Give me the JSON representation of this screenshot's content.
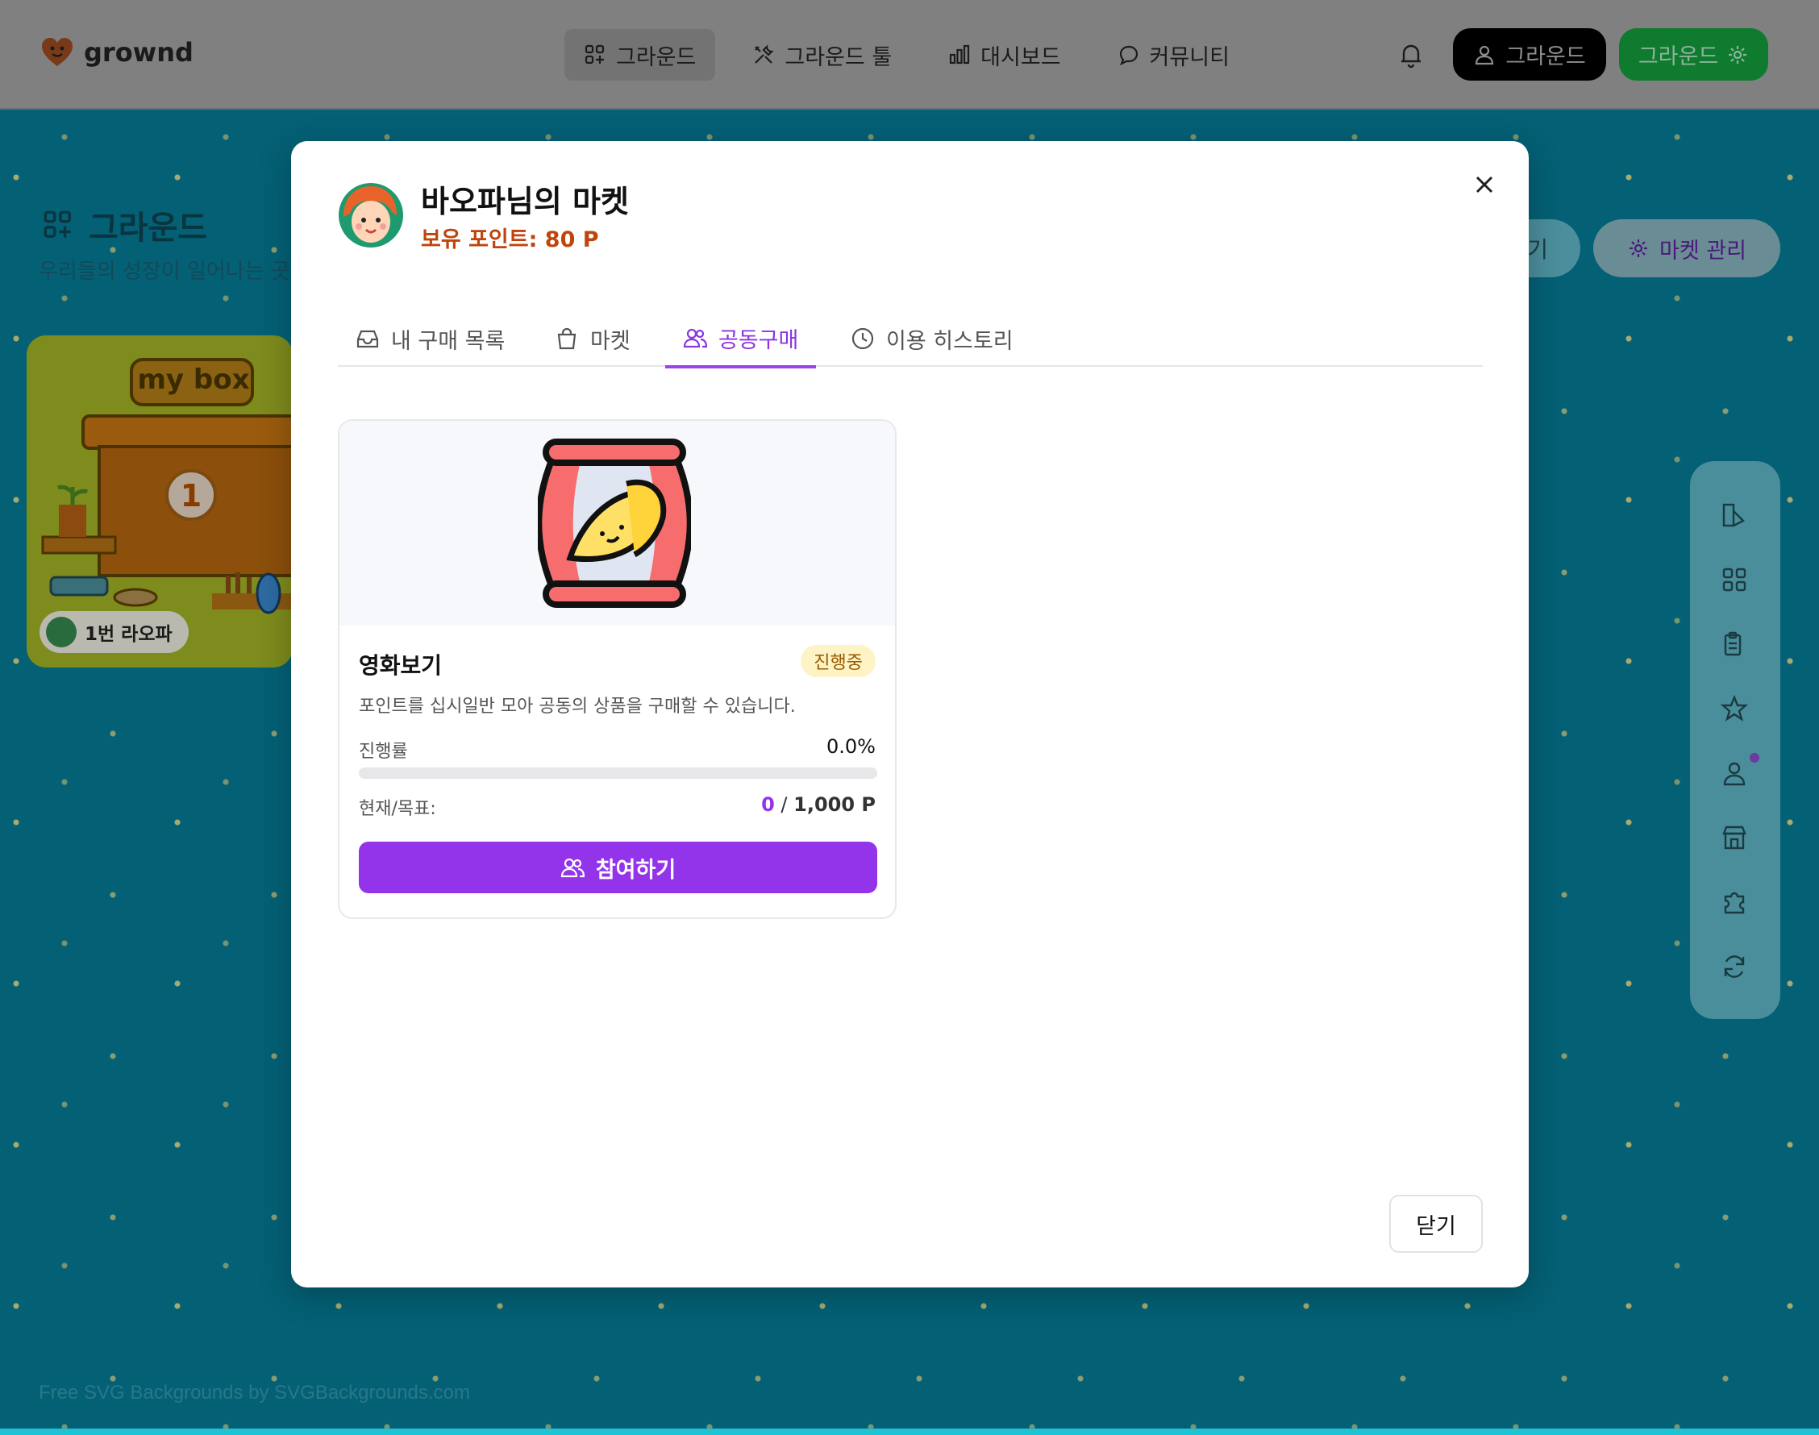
{
  "app": {
    "logo_text": "grownd"
  },
  "nav": [
    {
      "label": "그라운드",
      "icon": "grid-plus-icon",
      "active": true
    },
    {
      "label": "그라운드 툴",
      "icon": "tools-icon",
      "active": false
    },
    {
      "label": "대시보드",
      "icon": "bar-chart-icon",
      "active": false
    },
    {
      "label": "커뮤니티",
      "icon": "chat-bubble-icon",
      "active": false
    }
  ],
  "header_right": {
    "user_button": "그라운드",
    "ground_button": "그라운드"
  },
  "page": {
    "title": "그라운드",
    "subtitle": "우리들의 성장이 일어나는 곳",
    "btn_partial": "기",
    "btn_market_manage": "마켓 관리",
    "mybox_label": "1번 라오파",
    "credit": "Free SVG Backgrounds by SVGBackgrounds.com"
  },
  "modal": {
    "title": "바오파님의 마켓",
    "points": "보유 포인트: 80 P",
    "tabs": [
      {
        "label": "내 구매 목록",
        "icon": "inbox-icon"
      },
      {
        "label": "마켓",
        "icon": "shopping-bag-icon"
      },
      {
        "label": "공동구매",
        "icon": "users-icon"
      },
      {
        "label": "이용 히스토리",
        "icon": "clock-icon"
      }
    ],
    "active_tab": 2,
    "card": {
      "name": "영화보기",
      "status": "진행중",
      "description": "포인트를 십시일반 모아 공동의 상품을 구매할 수 있습니다.",
      "progress_label": "진행률",
      "progress_value": "0.0%",
      "progress_fraction": 0.0,
      "goal_label": "현재/목표:",
      "current": "0",
      "separator": " / ",
      "target": "1,000 P",
      "join_label": "참여하기"
    },
    "close_label": "닫기"
  },
  "colors": {
    "accent": "#9333ea",
    "points": "#c0450c",
    "background": "#05697f",
    "header": "#808080"
  }
}
